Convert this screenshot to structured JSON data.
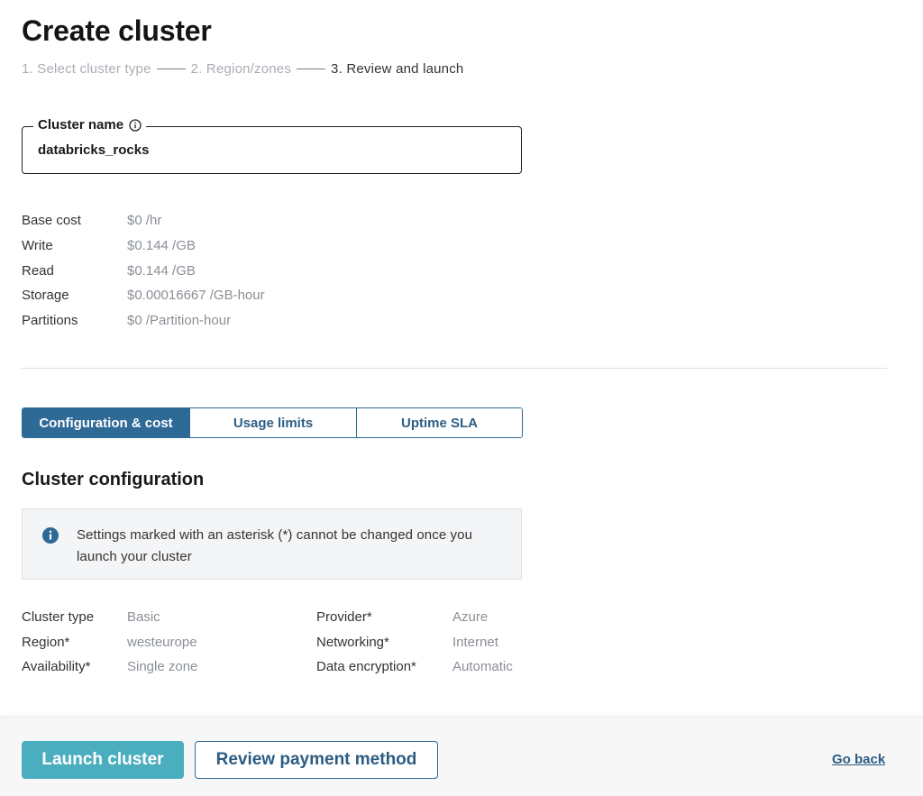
{
  "page": {
    "title": "Create cluster"
  },
  "stepper": {
    "steps": [
      "1. Select cluster type",
      "2. Region/zones",
      "3. Review and launch"
    ],
    "active_index": 2
  },
  "cluster_name": {
    "label": "Cluster name",
    "value": "databricks_rocks"
  },
  "costs": [
    {
      "label": "Base cost",
      "value": "$0 /hr"
    },
    {
      "label": "Write",
      "value": "$0.144 /GB"
    },
    {
      "label": "Read",
      "value": "$0.144 /GB"
    },
    {
      "label": "Storage",
      "value": "$0.00016667 /GB-hour"
    },
    {
      "label": "Partitions",
      "value": "$0 /Partition-hour"
    }
  ],
  "tabs": [
    {
      "label": "Configuration & cost",
      "active": true
    },
    {
      "label": "Usage limits",
      "active": false
    },
    {
      "label": "Uptime SLA",
      "active": false
    }
  ],
  "section": {
    "title": "Cluster configuration"
  },
  "notice": {
    "icon": "info-icon",
    "text": "Settings marked with an asterisk (*) cannot be changed once you launch your cluster"
  },
  "config": [
    {
      "label1": "Cluster type",
      "value1": "Basic",
      "label2": "Provider*",
      "value2": "Azure"
    },
    {
      "label1": "Region*",
      "value1": "westeurope",
      "label2": "Networking*",
      "value2": "Internet"
    },
    {
      "label1": "Availability*",
      "value1": "Single zone",
      "label2": "Data encryption*",
      "value2": "Automatic"
    }
  ],
  "footer": {
    "launch_label": "Launch cluster",
    "payment_label": "Review payment method",
    "go_back_label": "Go back"
  },
  "colors": {
    "accent": "#2f6a96",
    "launch_button": "#4baebf",
    "link": "#2c5c82"
  }
}
